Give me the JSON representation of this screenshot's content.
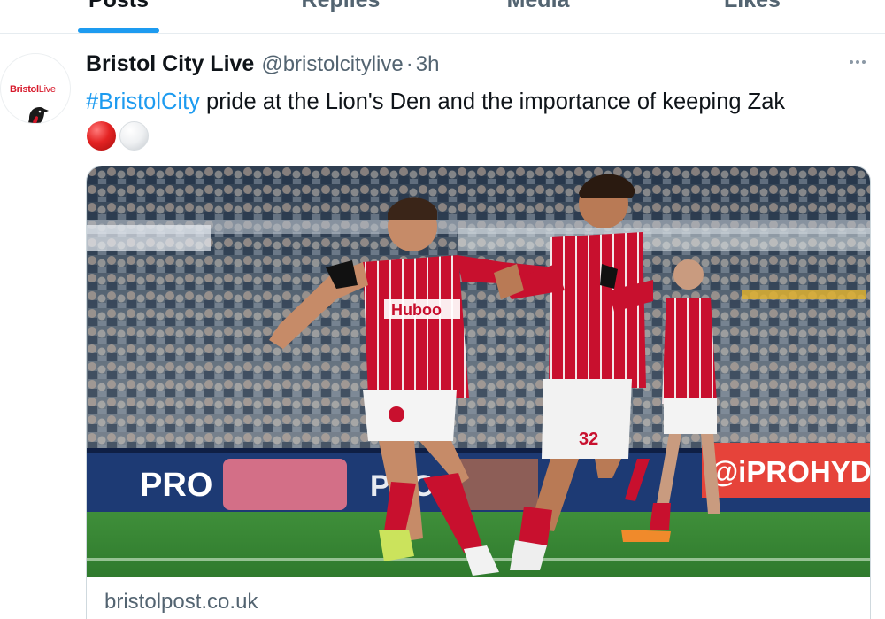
{
  "tabs": [
    {
      "label": "Posts",
      "active": true
    },
    {
      "label": "Replies",
      "active": false
    },
    {
      "label": "Media",
      "active": false
    },
    {
      "label": "Likes",
      "active": false
    }
  ],
  "tweet": {
    "avatar": {
      "brand_main": "Bristol",
      "brand_sub": "Live"
    },
    "display_name": "Bristol City Live",
    "handle": "@bristolcitylive",
    "separator": "·",
    "time": "3h",
    "hashtag": "#BristolCity",
    "text_rest": " pride at the Lion's Den and the importance of keeping Zak",
    "emojis": [
      "red-circle",
      "white-circle"
    ],
    "card": {
      "domain": "bristolpost.co.uk",
      "image": {
        "shirt_sponsor": "Huboo",
        "board_left": "PRO",
        "board_right": "@iPROHYD",
        "shirt_number": "32"
      }
    }
  },
  "colors": {
    "accent": "#1d9bf0",
    "text": "#0f1419",
    "muted": "#536471",
    "kit_red": "#c8102e"
  }
}
